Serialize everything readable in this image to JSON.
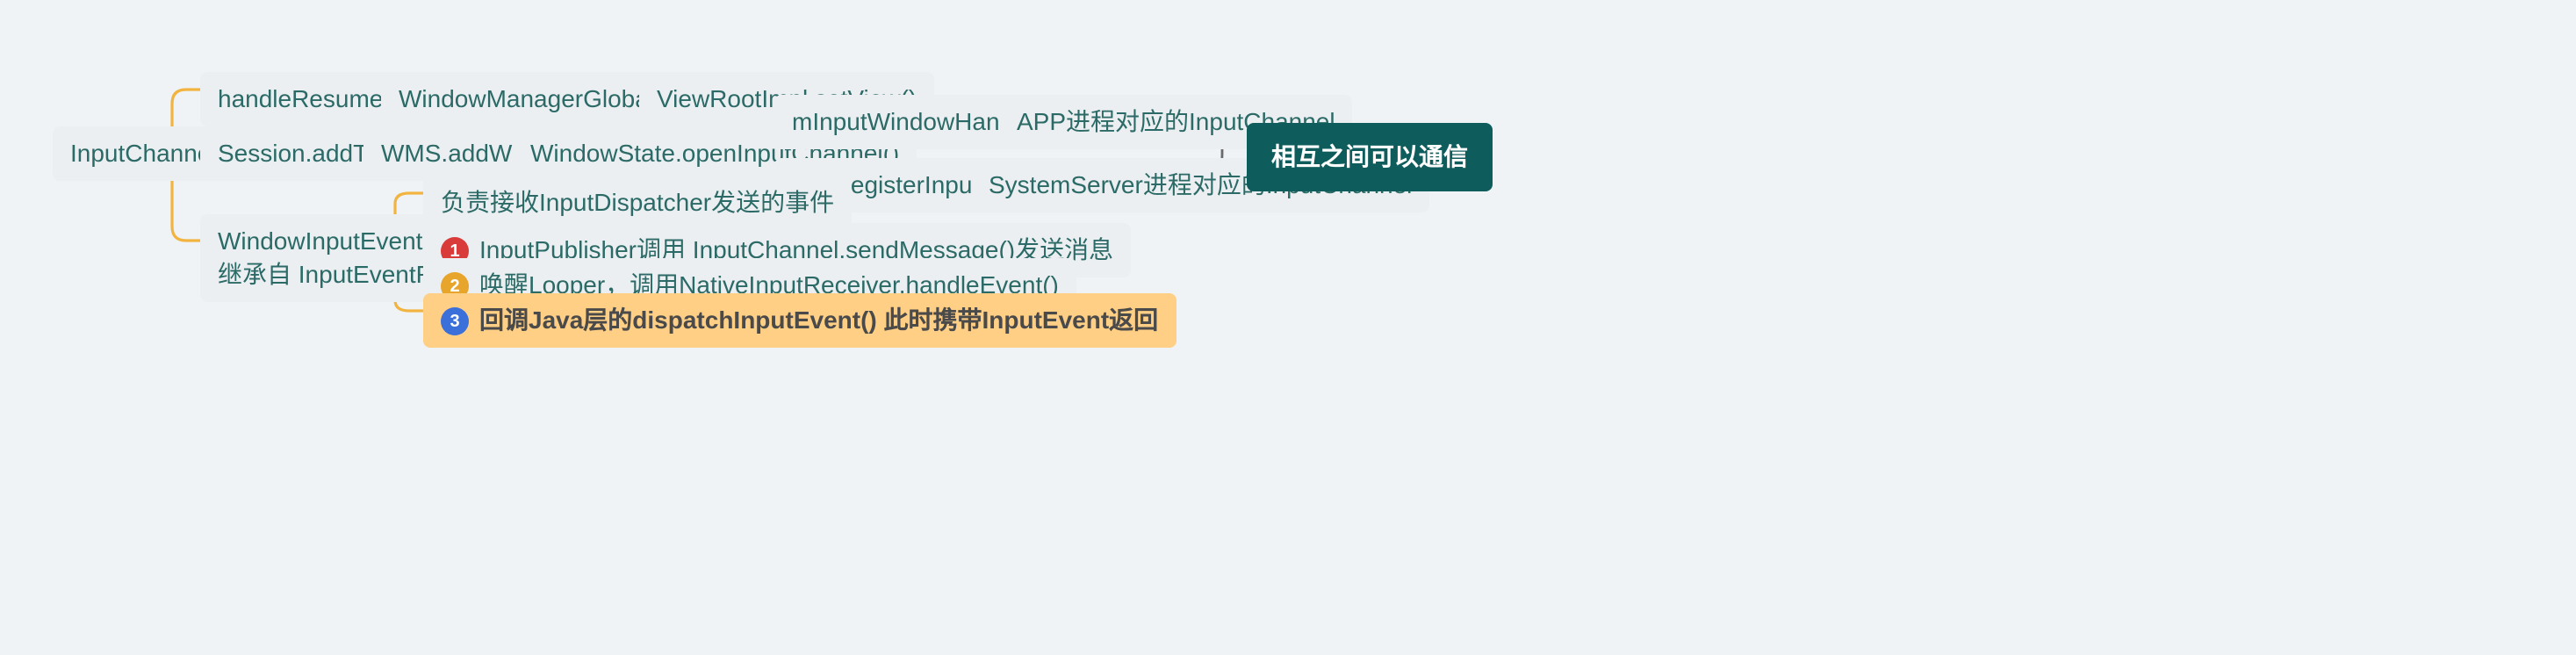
{
  "root": "InputChannel注册",
  "branch1": {
    "n1": "handleResumeActivity()",
    "n2": "WindowManagerGlobal.addView()",
    "n3": "ViewRootImpl.setView()"
  },
  "branch2": {
    "n1": "Session.addToDisplay()",
    "n2": "WMS.addWindow()",
    "n3": "WindowState.openInputChannel()",
    "c1": "mInputWindowHandle.inputChannel",
    "c1b": "APP进程对应的InputChannel",
    "c2": "IMS.registerInputChannel()",
    "c2b": "SystemServer进程对应的InputChannel",
    "result": "相互之间可以通信"
  },
  "branch3": {
    "titleA": "WindowInputEventReceiver",
    "titleB": "继承自 InputEventReceiver",
    "r0": "负责接收InputDispatcher发送的事件",
    "r1": "InputPublisher调用 InputChannel.sendMessage()发送消息",
    "r2": "唤醒Looper，调用NativeInputReceiver.handleEvent()",
    "r3": "回调Java层的dispatchInputEvent() 此时携带InputEvent返回"
  },
  "badges": {
    "b1": "1",
    "b2": "2",
    "b3": "3"
  }
}
